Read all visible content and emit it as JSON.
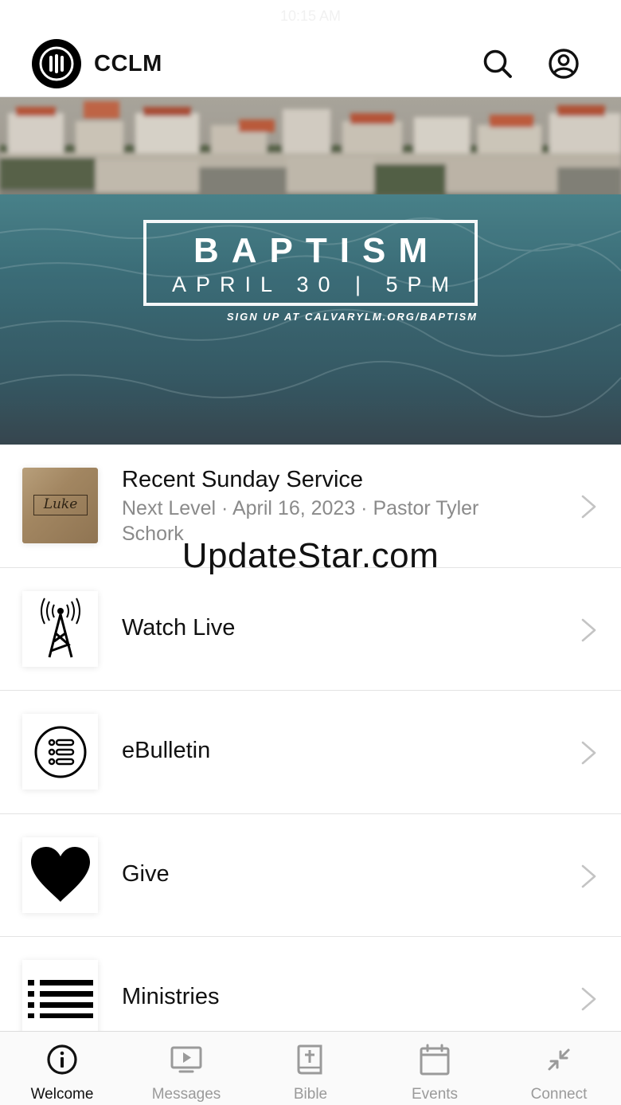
{
  "status_bar": {
    "time": "10:15 AM"
  },
  "header": {
    "app_title": "CCLM",
    "logo_icon": "cclm-logo",
    "search_icon": "search-icon",
    "profile_icon": "account-circle-icon"
  },
  "hero": {
    "title": "BAPTISM",
    "date_line": "APRIL 30 | 5PM",
    "signup": "SIGN UP AT CALVARYLM.ORG/BAPTISM"
  },
  "menu": {
    "items": [
      {
        "title": "Recent Sunday Service",
        "subtitle": "Next Level · April 16, 2023 · Pastor Tyler Schork",
        "thumb_text": "Luke",
        "icon": "sermon-thumbnail"
      },
      {
        "title": "Watch Live",
        "icon": "broadcast-tower-icon"
      },
      {
        "title": "eBulletin",
        "icon": "list-circle-icon"
      },
      {
        "title": "Give",
        "icon": "heart-icon"
      },
      {
        "title": "Ministries",
        "icon": "list-icon"
      }
    ],
    "chevron_icon": "chevron-right-icon"
  },
  "watermark": "UpdateStar.com",
  "tabs": [
    {
      "label": "Welcome",
      "icon": "info-icon",
      "active": true
    },
    {
      "label": "Messages",
      "icon": "play-screen-icon",
      "active": false
    },
    {
      "label": "Bible",
      "icon": "bible-icon",
      "active": false
    },
    {
      "label": "Events",
      "icon": "calendar-icon",
      "active": false
    },
    {
      "label": "Connect",
      "icon": "connect-arrows-icon",
      "active": false
    }
  ],
  "colors": {
    "active_tab": "#111111",
    "inactive_tab": "#9a9a9a",
    "divider": "#e3e3e3",
    "subtitle": "#8a8a8a"
  }
}
